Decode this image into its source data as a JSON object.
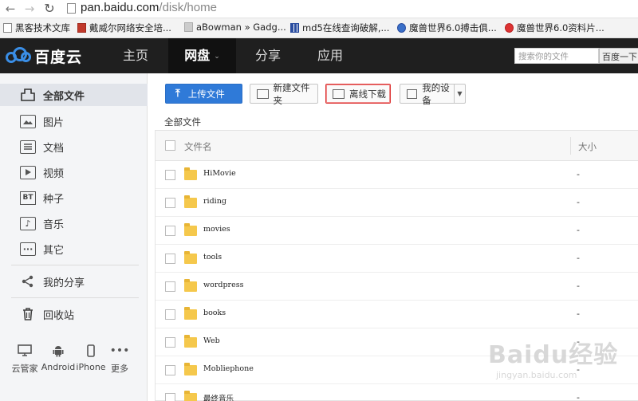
{
  "browser": {
    "url_host": "pan.baidu.com",
    "url_path": "/disk/home"
  },
  "bookmarks": [
    {
      "label": "黑客技术文库",
      "icon": "page-icon"
    },
    {
      "label": "戴威尔网络安全培...",
      "icon": "red-d-icon"
    },
    {
      "label": "aBowman » Gadg...",
      "icon": "ab-icon"
    },
    {
      "label": "md5在线查询破解,...",
      "icon": "grid-icon"
    },
    {
      "label": "魔兽世界6.0搏击俱...",
      "icon": "globe-icon"
    },
    {
      "label": "魔兽世界6.0资料片...",
      "icon": "bird-icon"
    }
  ],
  "header": {
    "logo_text": "百度云",
    "nav": [
      "主页",
      "网盘",
      "分享",
      "应用"
    ],
    "search_placeholder": "搜索你的文件",
    "search_button": "百度一下"
  },
  "sidebar": {
    "items": [
      {
        "label": "全部文件",
        "icon": "folder-outline-icon"
      },
      {
        "label": "图片",
        "icon": "image-icon"
      },
      {
        "label": "文档",
        "icon": "document-icon"
      },
      {
        "label": "视频",
        "icon": "video-icon"
      },
      {
        "label": "种子",
        "icon": "bt-icon"
      },
      {
        "label": "音乐",
        "icon": "music-icon"
      },
      {
        "label": "其它",
        "icon": "more-icon"
      },
      {
        "label": "我的分享",
        "icon": "share-icon"
      },
      {
        "label": "回收站",
        "icon": "trash-icon"
      }
    ],
    "devices": [
      {
        "label": "云管家",
        "icon": "monitor-icon"
      },
      {
        "label": "Android",
        "icon": "android-icon"
      },
      {
        "label": "iPhone",
        "icon": "iphone-icon"
      },
      {
        "label": "更多",
        "icon": "more-dots-icon"
      }
    ]
  },
  "toolbar": {
    "upload": "上传文件",
    "new_folder": "新建文件夹",
    "offline_download": "离线下载",
    "my_devices": "我的设备"
  },
  "breadcrumb": "全部文件",
  "table": {
    "col_name": "文件名",
    "col_size": "大小",
    "rows": [
      {
        "name": "HiMovie",
        "size": "-"
      },
      {
        "name": "riding",
        "size": "-"
      },
      {
        "name": "movies",
        "size": "-"
      },
      {
        "name": "tools",
        "size": "-"
      },
      {
        "name": "wordpress",
        "size": "-"
      },
      {
        "name": "books",
        "size": "-"
      },
      {
        "name": "Web",
        "size": "-"
      },
      {
        "name": "Mobliephone",
        "size": "-"
      },
      {
        "name": "最终音乐",
        "size": "-"
      }
    ]
  },
  "watermark": {
    "main": "Baidu经验",
    "sub": "jingyan.baidu.com"
  }
}
